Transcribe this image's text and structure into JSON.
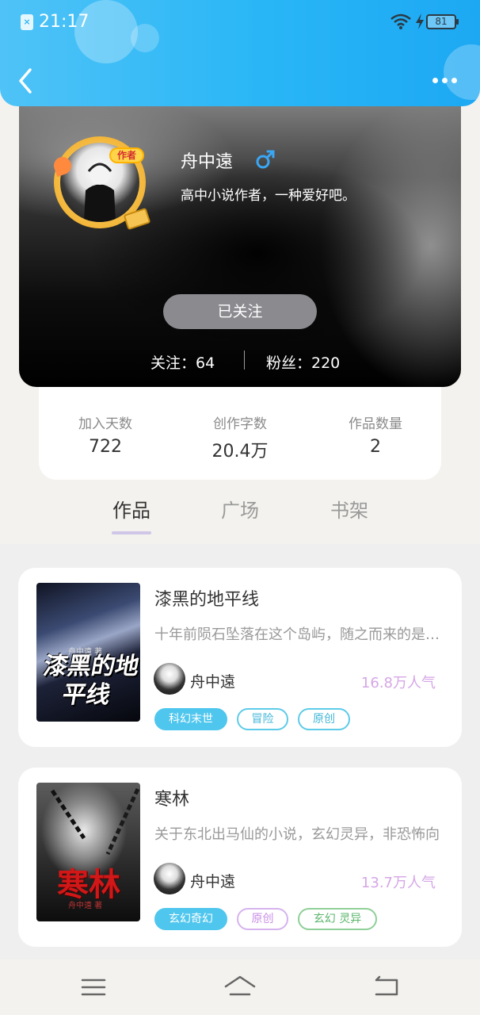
{
  "status_bar": {
    "sim_label": "×",
    "time": "21:17",
    "battery": "81"
  },
  "header": {
    "back_icon": "chevron-left-icon",
    "more_icon": "more-dots-icon"
  },
  "profile": {
    "avatar_badge": "作者",
    "name": "舟中遠",
    "gender_icon": "male-icon",
    "bio": "高中小说作者，一种爱好吧。",
    "follow_button": "已关注",
    "following": "关注：64",
    "fans": "粉丝：220"
  },
  "stats": [
    {
      "label": "加入天数",
      "value": "722"
    },
    {
      "label": "创作字数",
      "value": "20.4万"
    },
    {
      "label": "作品数量",
      "value": "2"
    }
  ],
  "tabs": [
    {
      "label": "作品",
      "active": true
    },
    {
      "label": "广场",
      "active": false
    },
    {
      "label": "书架",
      "active": false
    }
  ],
  "books": [
    {
      "title": "漆黑的地平线",
      "description": "十年前陨石坠落在这个岛屿，随之而来的是怪物",
      "author": "舟中遠",
      "popularity": "16.8万人气",
      "cover_title": "漆黑的地平线",
      "cover_author": "舟中遠 著",
      "tags": [
        {
          "label": "科幻末世",
          "style": "solid"
        },
        {
          "label": "冒险",
          "style": "cyan"
        },
        {
          "label": "原创",
          "style": "cyan"
        }
      ]
    },
    {
      "title": "寒林",
      "description": "关于东北出马仙的小说，玄幻灵异，非恐怖向",
      "author": "舟中遠",
      "popularity": "13.7万人气",
      "cover_title": "寒林",
      "cover_author": "舟中遠 著",
      "tags": [
        {
          "label": "玄幻奇幻",
          "style": "solid"
        },
        {
          "label": "原创",
          "style": "purple"
        },
        {
          "label": "玄幻 灵异",
          "style": "green"
        }
      ]
    }
  ],
  "navbar": {
    "menu_icon": "menu-icon",
    "home_icon": "home-icon",
    "back_icon": "back-arrow-icon"
  },
  "colors": {
    "header_blue": "#29b6f6",
    "accent_purple": "#cfc6e8",
    "tag_blue": "#4fc6ee"
  }
}
